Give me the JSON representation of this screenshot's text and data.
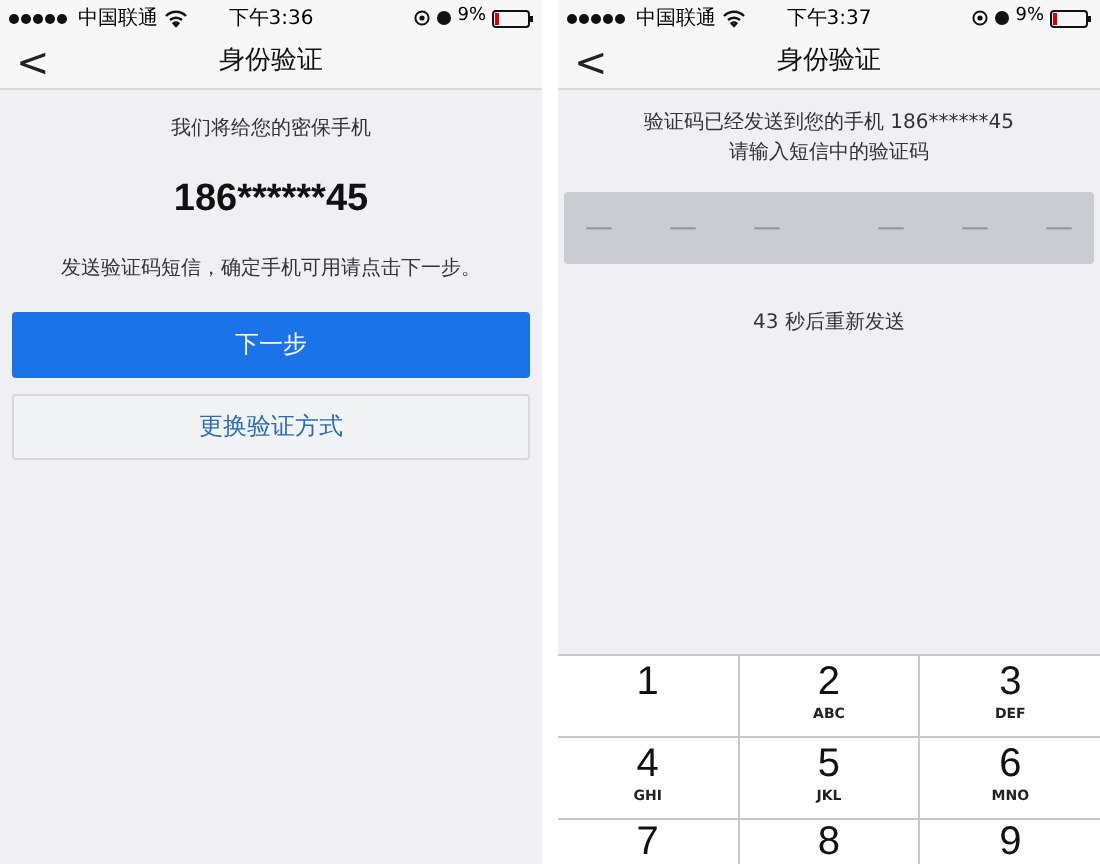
{
  "screens": [
    {
      "kind": "confirm",
      "status_bar": {
        "carrier": "中国联通",
        "time": "下午3:36",
        "battery": "9%"
      },
      "nav": {
        "back": "<",
        "title": "身份验证"
      },
      "intro": "我们将给您的密保手机",
      "phone": "186******45",
      "hint": "发送验证码短信，确定手机可用请点击下一步。",
      "buttons": [
        {
          "label": "下一步",
          "kind": "primary"
        },
        {
          "label": "更换验证方式",
          "kind": "secondary"
        }
      ]
    },
    {
      "kind": "code",
      "status_bar": {
        "carrier": "中国联通",
        "time": "下午3:37",
        "battery": "9%"
      },
      "nav": {
        "back": "<",
        "title": "身份验证"
      },
      "message_lines": [
        "验证码已经发送到您的手机 186******45",
        "请输入短信中的验证码"
      ],
      "code_slots": [
        {
          "char": "—"
        },
        {
          "char": "—"
        },
        {
          "char": "—"
        },
        {
          "char": "—"
        },
        {
          "char": "—"
        },
        {
          "char": "—"
        }
      ],
      "resend": "43 秒后重新发送",
      "keypad": [
        {
          "digit": "1"
        },
        {
          "digit": "2",
          "letters": "ABC"
        },
        {
          "digit": "3",
          "letters": "DEF"
        },
        {
          "digit": "4",
          "letters": "GHI"
        },
        {
          "digit": "5",
          "letters": "JKL"
        },
        {
          "digit": "6",
          "letters": "MNO"
        },
        {
          "digit": "7"
        },
        {
          "digit": "8"
        },
        {
          "digit": "9"
        }
      ]
    }
  ]
}
